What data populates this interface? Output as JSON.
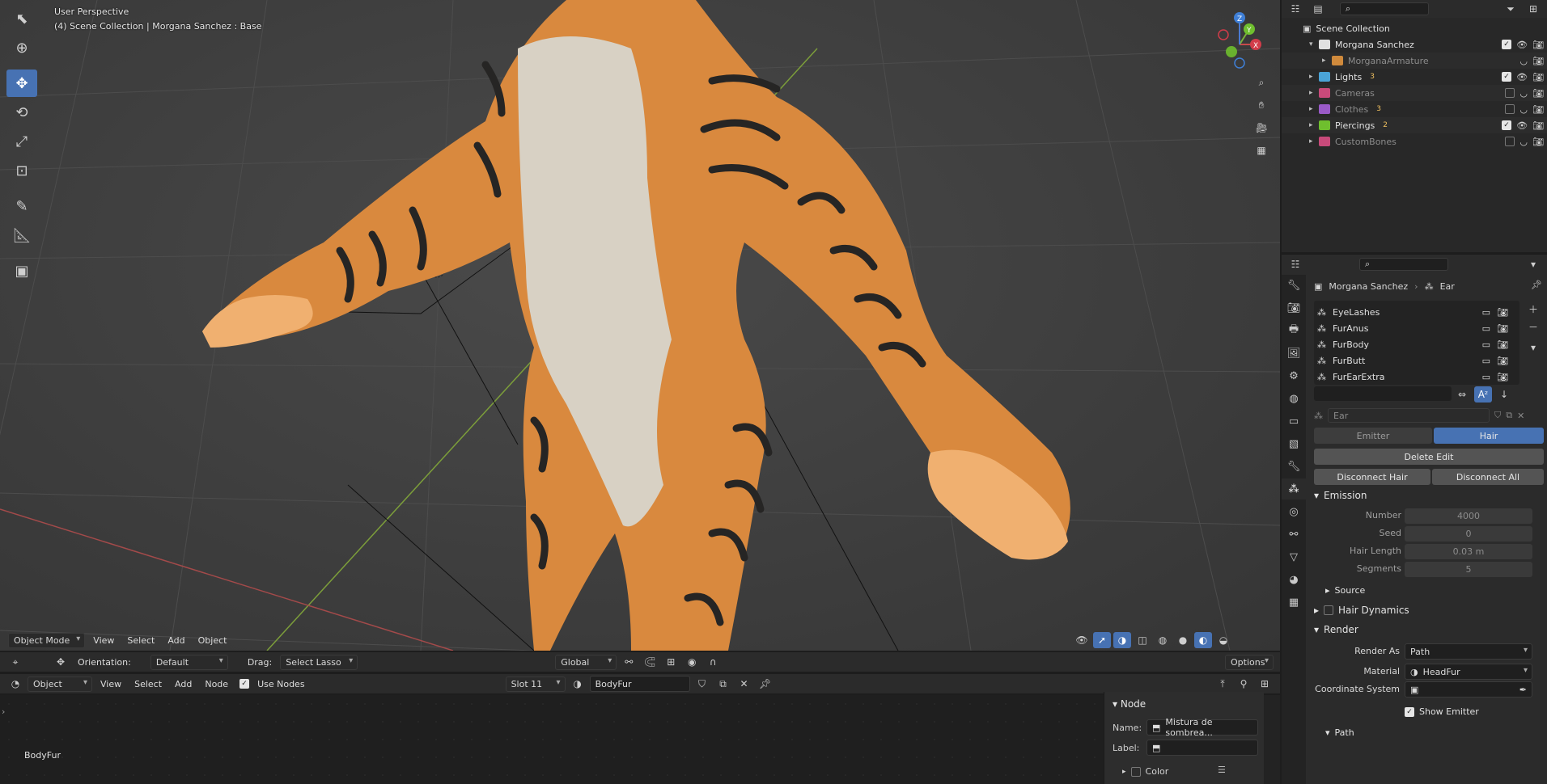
{
  "viewport": {
    "title": "User Perspective",
    "subtitle": "(4) Scene Collection | Morgana Sanchez : Base",
    "header": {
      "mode": "Object Mode",
      "menus": [
        "View",
        "Select",
        "Add",
        "Object"
      ]
    },
    "gizmo": {
      "x": "X",
      "y": "Y",
      "z": "Z"
    }
  },
  "tool_settings": {
    "orientation_label": "Orientation:",
    "orientation_value": "Default",
    "drag_label": "Drag:",
    "drag_value": "Select Lasso",
    "transform_orientation": "Global",
    "options_label": "Options"
  },
  "node_editor": {
    "type": "Object",
    "menus": [
      "View",
      "Select",
      "Add",
      "Node"
    ],
    "use_nodes_label": "Use Nodes",
    "slot": "Slot 11",
    "material": "BodyFur",
    "canvas_label": "BodyFur",
    "panel": {
      "title": "Node",
      "name_label": "Name:",
      "name_value": "Mistura de sombrea...",
      "label_label": "Label:",
      "label_value": "",
      "color_label": "Color"
    }
  },
  "outliner": {
    "root": "Scene Collection",
    "rows": [
      {
        "name": "Morgana Sanchez",
        "color": "#e0e0e0",
        "expanded": true,
        "dim": false,
        "checked": true
      },
      {
        "name": "MorganaArmature",
        "color": "#a9a9a9",
        "expanded": false,
        "dim": true,
        "checked": null
      },
      {
        "name": "Lights",
        "color": "#e0e0e0",
        "expanded": false,
        "dim": false,
        "checked": true,
        "badge": "3"
      },
      {
        "name": "Cameras",
        "color": "#8b8b8b",
        "expanded": false,
        "dim": true,
        "checked": false
      },
      {
        "name": "Clothes",
        "color": "#8b8b8b",
        "expanded": false,
        "dim": true,
        "checked": false,
        "badge": "3"
      },
      {
        "name": "Piercings",
        "color": "#e0e0e0",
        "expanded": false,
        "dim": false,
        "checked": true,
        "badge": "2"
      },
      {
        "name": "CustomBones",
        "color": "#8b8b8b",
        "expanded": false,
        "dim": true,
        "checked": false
      }
    ]
  },
  "properties": {
    "breadcrumb_object": "Morgana Sanchez",
    "breadcrumb_system": "Ear",
    "particle_list": [
      "EyeLashes",
      "FurAnus",
      "FurBody",
      "FurButt",
      "FurEarExtra"
    ],
    "settings_name": "Ear",
    "type_emitter": "Emitter",
    "type_hair": "Hair",
    "delete_edit": "Delete Edit",
    "disconnect_hair": "Disconnect Hair",
    "disconnect_all": "Disconnect All",
    "emission": {
      "title": "Emission",
      "number_label": "Number",
      "number_value": "4000",
      "seed_label": "Seed",
      "seed_value": "0",
      "hair_length_label": "Hair Length",
      "hair_length_value": "0.03 m",
      "segments_label": "Segments",
      "segments_value": "5",
      "source_label": "Source"
    },
    "hair_dynamics_label": "Hair Dynamics",
    "render": {
      "title": "Render",
      "render_as_label": "Render As",
      "render_as_value": "Path",
      "material_label": "Material",
      "material_value": "HeadFur",
      "coord_label": "Coordinate System",
      "show_emitter_label": "Show Emitter",
      "path_label": "Path"
    }
  }
}
